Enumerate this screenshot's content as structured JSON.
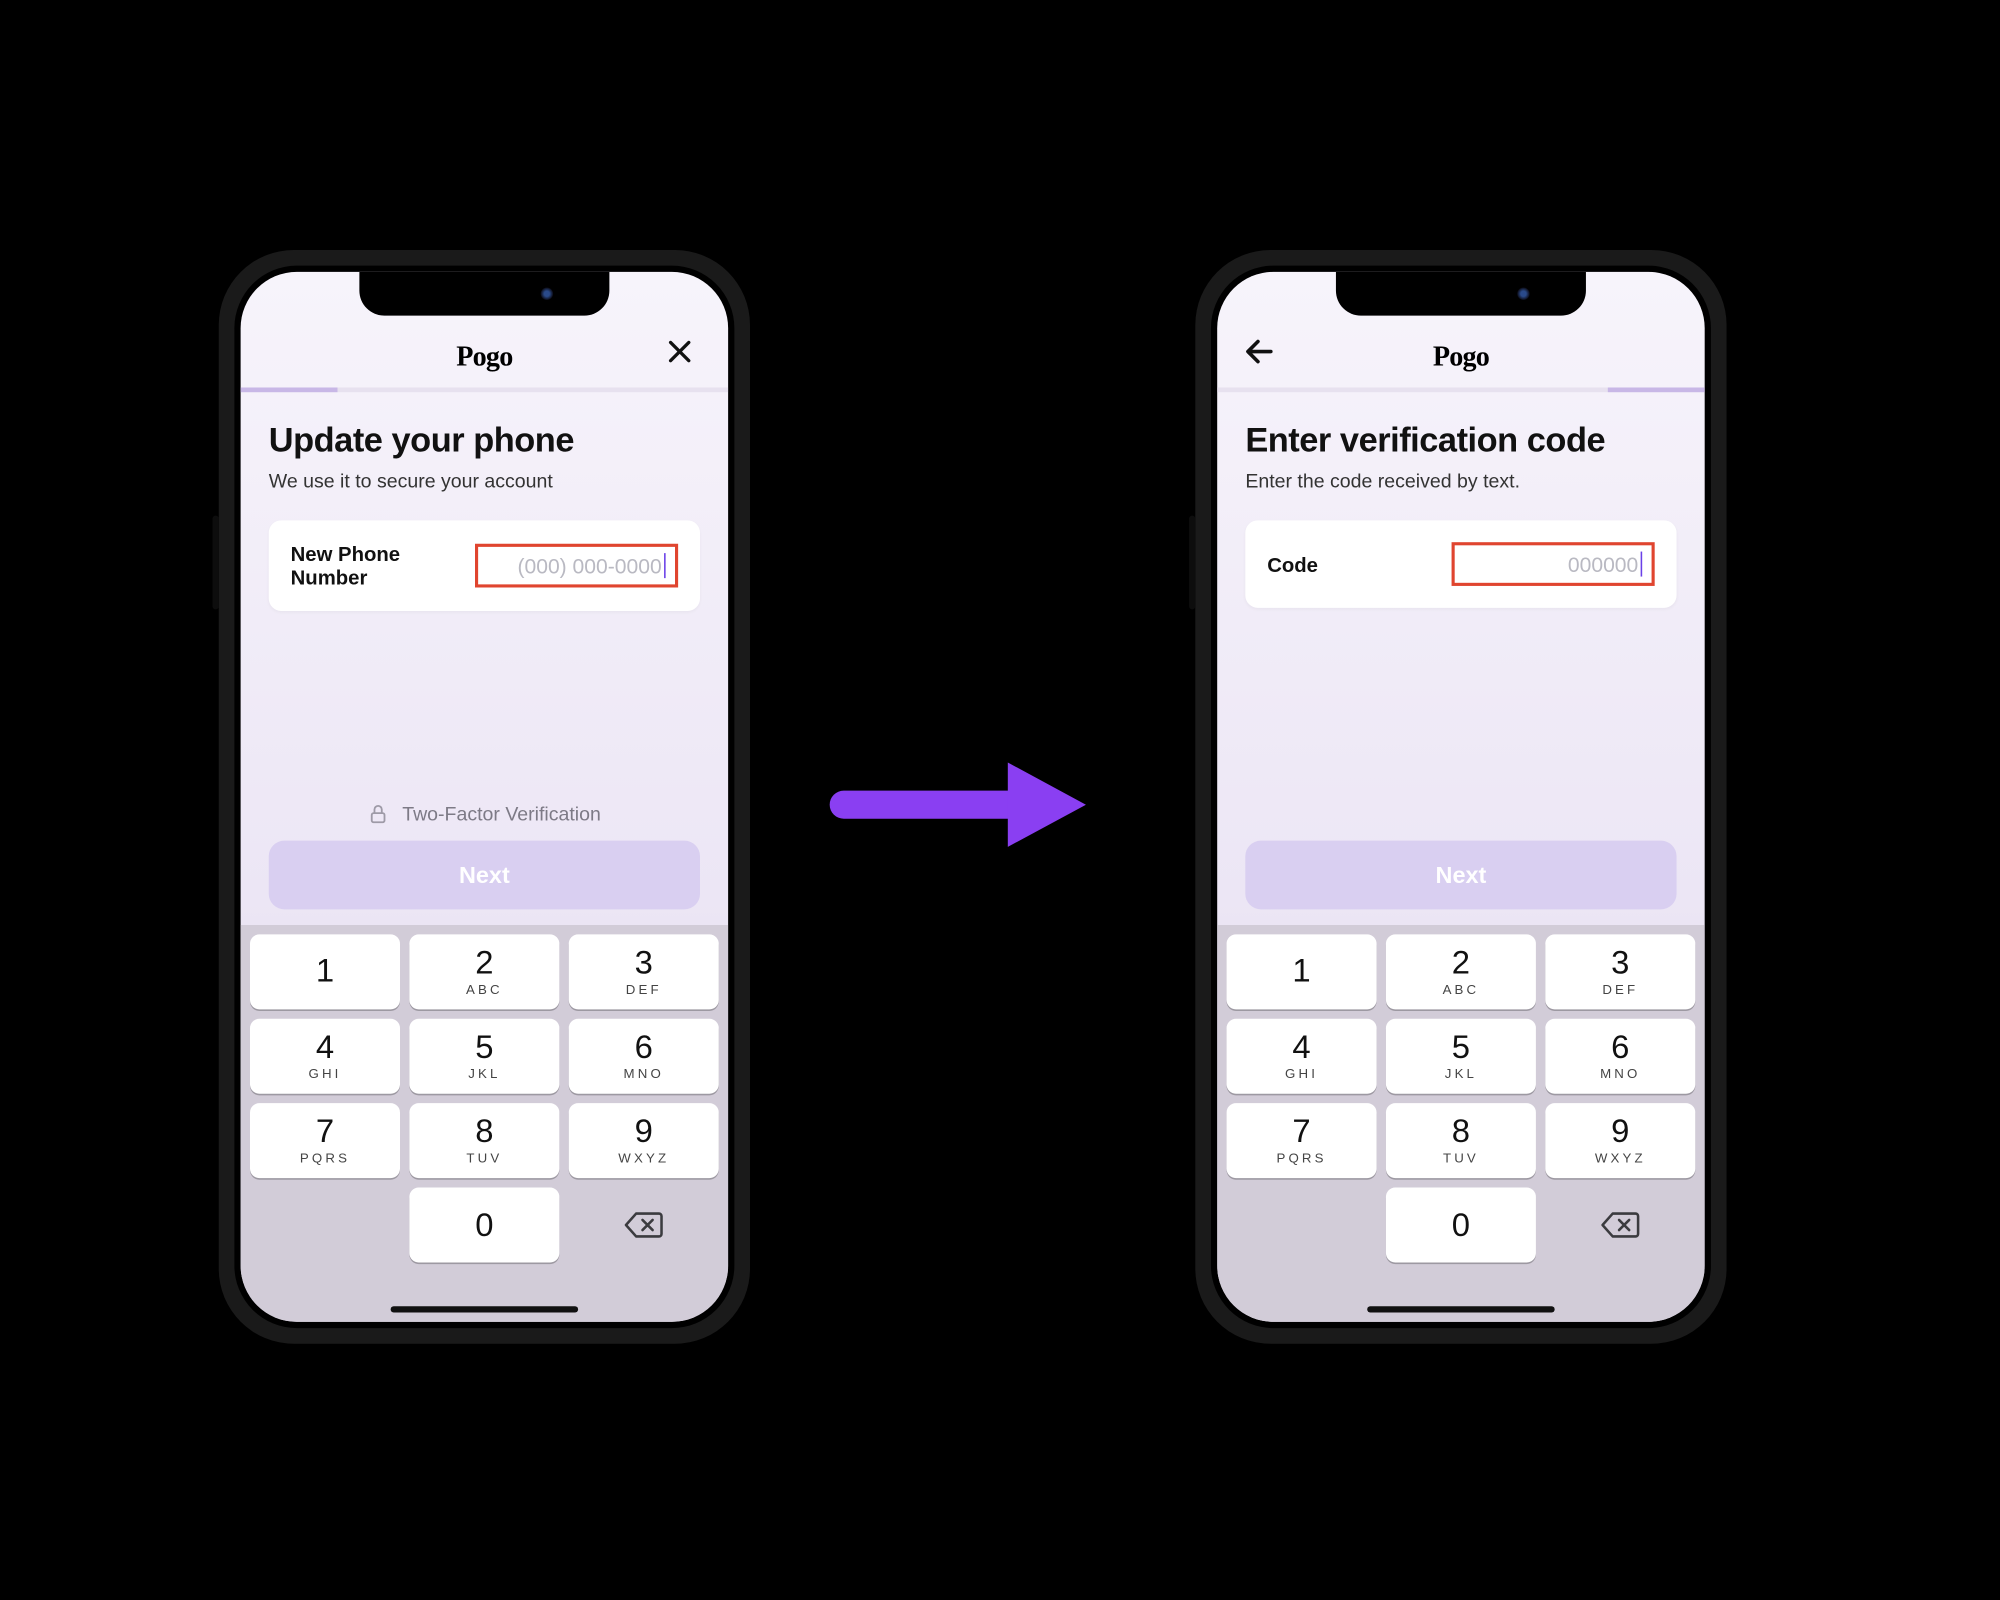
{
  "brand": "Pogo",
  "arrow_color": "#8a3ff2",
  "screens": {
    "left": {
      "nav_button": "close",
      "progress_segment": "start",
      "title": "Update your phone",
      "subtitle": "We use it to secure your account",
      "field_label": "New Phone Number",
      "field_placeholder": "(000) 000-0000",
      "twofa_label": "Two-Factor Verification",
      "primary_button": "Next"
    },
    "right": {
      "nav_button": "back",
      "progress_segment": "end",
      "title": "Enter verification code",
      "subtitle": "Enter the code received by text.",
      "field_label": "Code",
      "field_placeholder": "000000",
      "primary_button": "Next"
    }
  },
  "keypad": {
    "keys": [
      {
        "d": "1",
        "l": ""
      },
      {
        "d": "2",
        "l": "ABC"
      },
      {
        "d": "3",
        "l": "DEF"
      },
      {
        "d": "4",
        "l": "GHI"
      },
      {
        "d": "5",
        "l": "JKL"
      },
      {
        "d": "6",
        "l": "MNO"
      },
      {
        "d": "7",
        "l": "PQRS"
      },
      {
        "d": "8",
        "l": "TUV"
      },
      {
        "d": "9",
        "l": "WXYZ"
      },
      {
        "d": "0",
        "l": ""
      }
    ]
  }
}
